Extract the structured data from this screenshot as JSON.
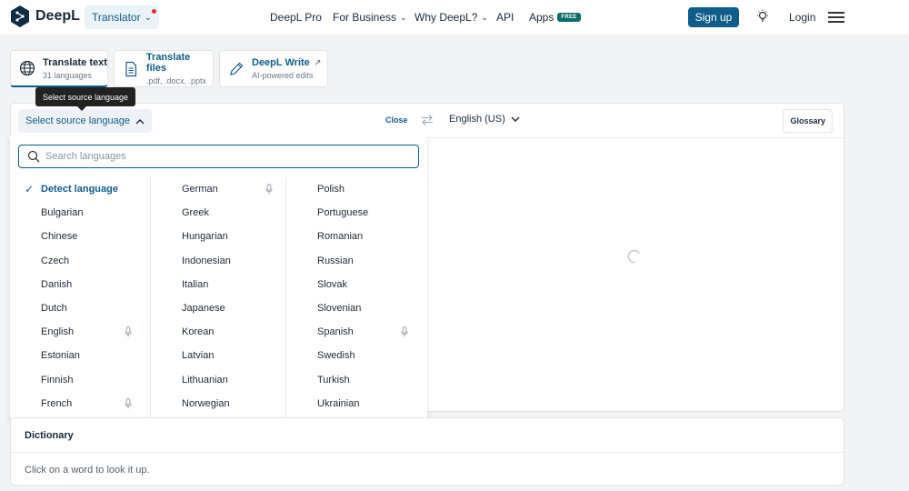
{
  "app": {
    "brand": "DeepL",
    "product_pill": "Translator"
  },
  "nav": {
    "pro": "DeepL Pro",
    "business": "For Business",
    "why": "Why DeepL?",
    "api": "API",
    "apps": "Apps",
    "free_badge": "FREE",
    "signup": "Sign up",
    "login": "Login"
  },
  "modes": [
    {
      "title": "Translate text",
      "subtitle": "31 languages"
    },
    {
      "title": "Translate files",
      "subtitle": ".pdf, .docx, .pptx"
    },
    {
      "title": "DeepL Write",
      "subtitle": "AI-powered edits"
    }
  ],
  "tooltip": "Select source language",
  "lang_bar": {
    "source_button": "Select source language",
    "close": "Close",
    "target": "English (US)",
    "glossary": "Glossary"
  },
  "search": {
    "placeholder": "Search languages",
    "value": ""
  },
  "languages": {
    "col1": [
      "Detect language",
      "Bulgarian",
      "Chinese",
      "Czech",
      "Danish",
      "Dutch",
      "English",
      "Estonian",
      "Finnish",
      "French"
    ],
    "col2": [
      "German",
      "Greek",
      "Hungarian",
      "Indonesian",
      "Italian",
      "Japanese",
      "Korean",
      "Latvian",
      "Lithuanian",
      "Norwegian"
    ],
    "col3": [
      "Polish",
      "Portuguese",
      "Romanian",
      "Russian",
      "Slovak",
      "Slovenian",
      "Spanish",
      "Swedish",
      "Turkish",
      "Ukrainian"
    ]
  },
  "dictionary": {
    "title": "Dictionary",
    "hint": "Click on a word to look it up."
  },
  "colors": {
    "accent": "#0f5d8a",
    "badge": "#0f6b6b",
    "dot": "#e03131"
  }
}
